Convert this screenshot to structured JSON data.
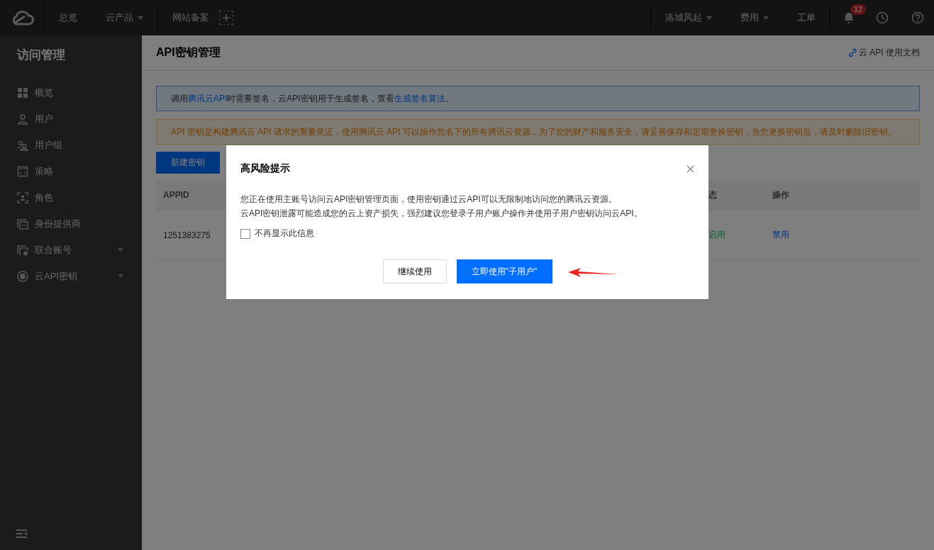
{
  "topbar": {
    "nav_left": [
      {
        "label": "总览",
        "dropdown": false
      },
      {
        "label": "云产品",
        "dropdown": true
      }
    ],
    "record": "网站备案",
    "nav_right": [
      {
        "label": "洛城风起",
        "dropdown": true
      },
      {
        "label": "费用",
        "dropdown": true
      },
      {
        "label": "工单",
        "dropdown": false
      }
    ],
    "notification_count": "12"
  },
  "sidebar": {
    "title": "访问管理",
    "items": [
      {
        "label": "概览",
        "expandable": false
      },
      {
        "label": "用户",
        "expandable": false
      },
      {
        "label": "用户组",
        "expandable": false
      },
      {
        "label": "策略",
        "expandable": false
      },
      {
        "label": "角色",
        "expandable": false
      },
      {
        "label": "身份提供商",
        "expandable": false
      },
      {
        "label": "联合账号",
        "expandable": true
      },
      {
        "label": "云API密钥",
        "expandable": true
      }
    ]
  },
  "page": {
    "title": "API密钥管理",
    "doc_link": "云 API 使用文档",
    "info": [
      {
        "text": "调用",
        "link": false
      },
      {
        "text": "腾讯云API",
        "link": true
      },
      {
        "text": "时需要签名，云API密钥用于生成签名，查看",
        "link": false
      },
      {
        "text": "生成签名算法",
        "link": true
      },
      {
        "text": "。",
        "link": false
      }
    ],
    "warning": "API 密钥是构建腾讯云 API 请求的重要凭证，使用腾讯云 API 可以操作您名下的所有腾讯云资源，为了您的财产和服务安全，请妥善保存和定期更换密钥，当您更换密钥后，请及时删除旧密钥。",
    "new_button": "新建密钥",
    "table": {
      "columns": [
        "APPID",
        "态",
        "操作"
      ],
      "rows": [
        {
          "appid": "1251383275",
          "status": "启用",
          "action": "禁用"
        }
      ]
    }
  },
  "dialog": {
    "title": "高风险提示",
    "lines": [
      "您正在使用主账号访问云API密钥管理页面，使用密钥通过云API可以无限制地访问您的腾讯云资源。",
      "云API密钥泄露可能造成您的云上资产损失，强烈建议您登录子用户账户操作并使用子用户密钥访问云API。"
    ],
    "checkbox": {
      "label": "不再显示此信息",
      "checked": false
    },
    "buttons": [
      {
        "label": "继续使用",
        "kind": "secondary"
      },
      {
        "label": "立即使用\"子用户\"",
        "kind": "primary"
      }
    ]
  }
}
